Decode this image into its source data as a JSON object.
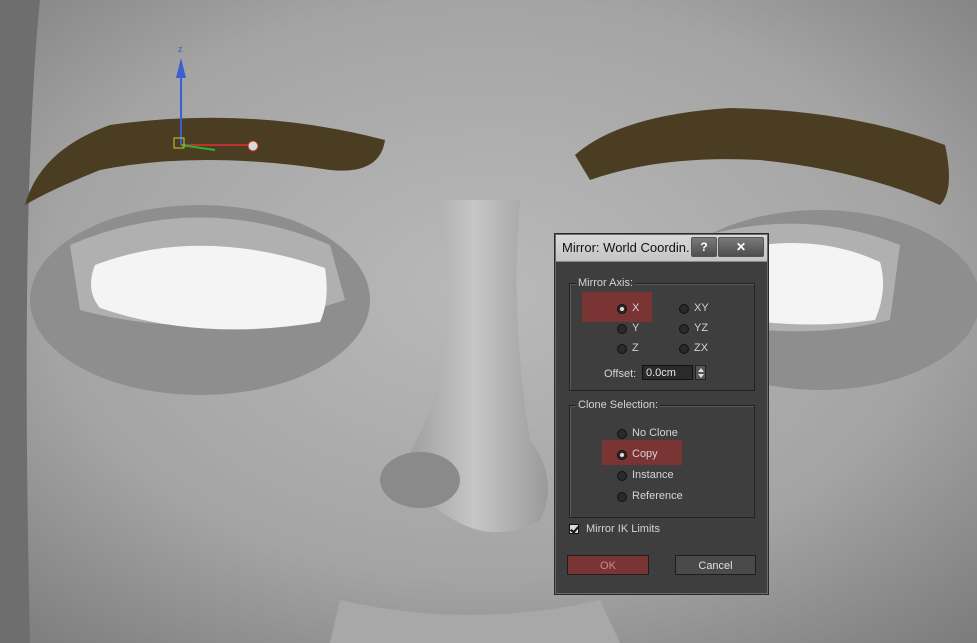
{
  "viewport": {
    "gizmo_label": "z"
  },
  "dialog": {
    "title": "Mirror: World Coordin...",
    "help_label": "?",
    "close_label": "✕",
    "mirror_axis": {
      "legend": "Mirror Axis:",
      "options": [
        "X",
        "Y",
        "Z",
        "XY",
        "YZ",
        "ZX"
      ],
      "selected": "X",
      "offset_label": "Offset:",
      "offset_value": "0.0cm"
    },
    "clone_selection": {
      "legend": "Clone Selection:",
      "options": [
        "No Clone",
        "Copy",
        "Instance",
        "Reference"
      ],
      "selected": "Copy"
    },
    "mirror_ik": {
      "label": "Mirror IK Limits",
      "checked": true
    },
    "ok_label": "OK",
    "cancel_label": "Cancel"
  },
  "colors": {
    "highlight": "#7b3434",
    "dialog_bg": "#3e3e3e",
    "eyebrow": "#4a3d22"
  }
}
